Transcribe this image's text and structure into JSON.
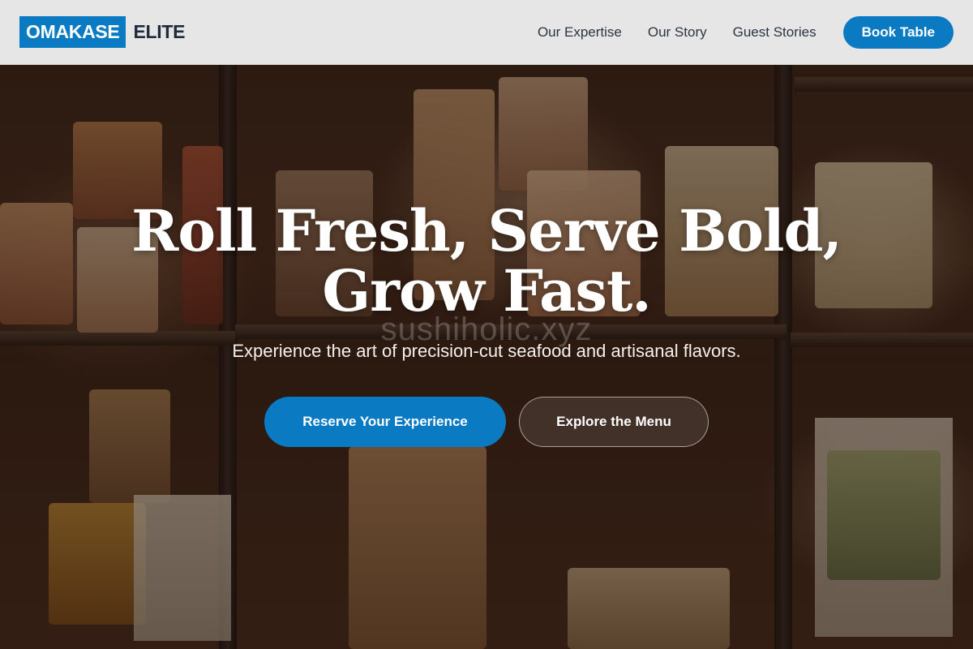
{
  "brand": {
    "primary": "OMAKASE",
    "secondary": "ELITE",
    "accent_color": "#0a7ac2"
  },
  "nav": {
    "items": [
      "Our Expertise",
      "Our Story",
      "Guest Stories"
    ],
    "cta_label": "Book Table"
  },
  "hero": {
    "title_line1": "Roll Fresh, Serve Bold,",
    "title_line2": "Grow Fast.",
    "watermark": "sushiholic.xyz",
    "subtitle": "Experience the art of precision-cut seafood and artisanal flavors.",
    "primary_cta": "Reserve Your Experience",
    "secondary_cta": "Explore the Menu"
  }
}
